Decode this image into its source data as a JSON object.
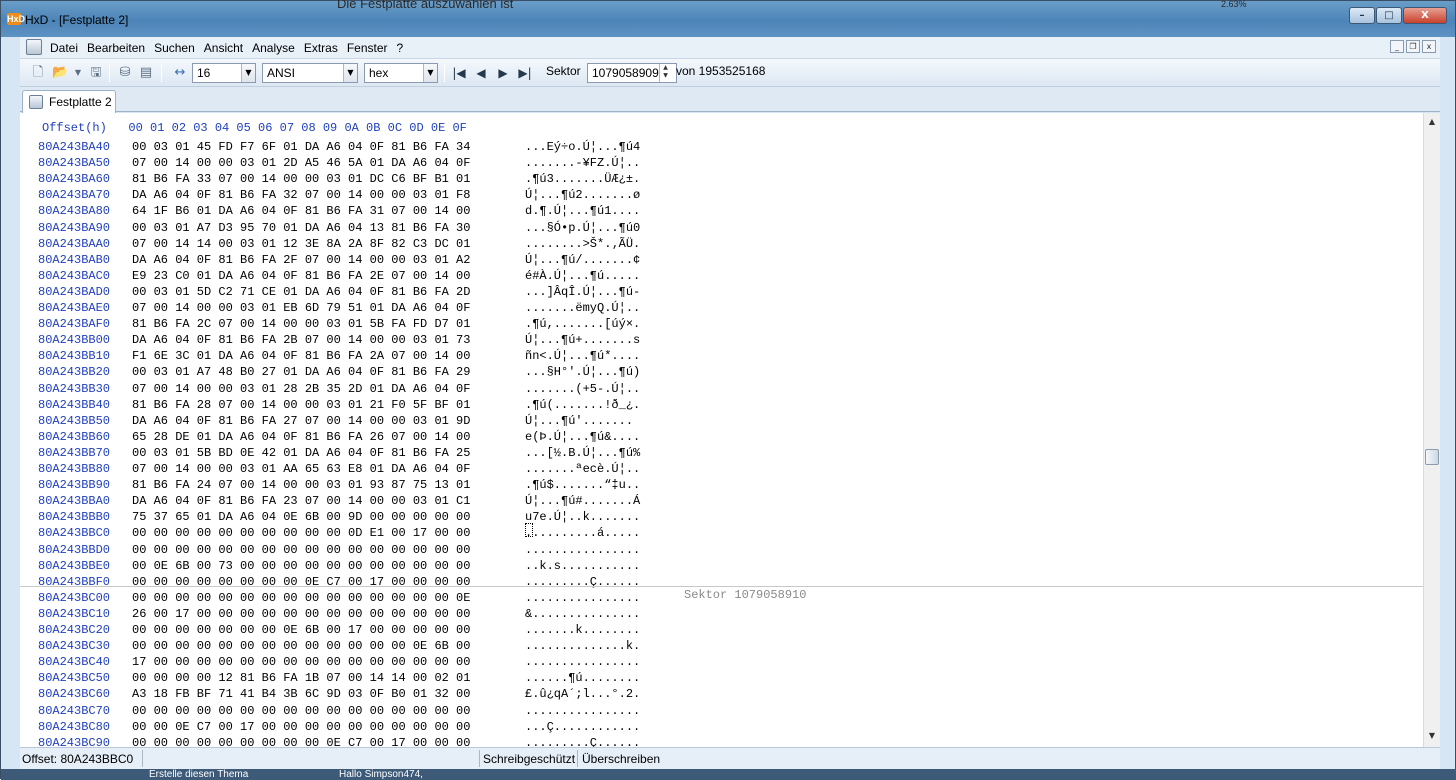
{
  "window": {
    "title": "HxD - [Festplatte 2]",
    "app_icon": "HxD",
    "bg_text_top": "Die Festplatte auszuwählen ist",
    "bg_text_right": "2.63%",
    "controls": {
      "minimize": "–",
      "maximize": "□",
      "close": "X"
    }
  },
  "menu": {
    "items": [
      "Datei",
      "Bearbeiten",
      "Suchen",
      "Ansicht",
      "Analyse",
      "Extras",
      "Fenster",
      "?"
    ],
    "mdi_controls": [
      "_",
      "❐",
      "x"
    ]
  },
  "toolbar": {
    "bytes_per_row": "16",
    "charset": "ANSI",
    "offset_base": "hex",
    "sector_label": "Sektor",
    "sector_value": "1079058909",
    "sector_total": "von 1953525168",
    "icons": [
      "new-icon",
      "open-icon",
      "save-icon",
      "disk-icon",
      "ram-icon",
      "columns-icon",
      "first-icon",
      "prev-icon",
      "next-icon",
      "last-icon"
    ]
  },
  "tab": {
    "label": "Festplatte 2"
  },
  "editor": {
    "header": "Offset(h)   00 01 02 03 04 05 06 07 08 09 0A 0B 0C 0D 0E 0F",
    "sector_label": "Sektor 1079058910",
    "rows": [
      {
        "offset": "80A243BA40",
        "hex": "00 03 01 45 FD F7 6F 01 DA A6 04 0F 81 B6 FA 34",
        "ascii": "...Eý÷o.Ú¦...¶ú4"
      },
      {
        "offset": "80A243BA50",
        "hex": "07 00 14 00 00 03 01 2D A5 46 5A 01 DA A6 04 0F",
        "ascii": ".......-¥FZ.Ú¦.."
      },
      {
        "offset": "80A243BA60",
        "hex": "81 B6 FA 33 07 00 14 00 00 03 01 DC C6 BF B1 01",
        "ascii": ".¶ú3.......ÜÆ¿±."
      },
      {
        "offset": "80A243BA70",
        "hex": "DA A6 04 0F 81 B6 FA 32 07 00 14 00 00 03 01 F8",
        "ascii": "Ú¦...¶ú2.......ø"
      },
      {
        "offset": "80A243BA80",
        "hex": "64 1F B6 01 DA A6 04 0F 81 B6 FA 31 07 00 14 00",
        "ascii": "d.¶.Ú¦...¶ú1...."
      },
      {
        "offset": "80A243BA90",
        "hex": "00 03 01 A7 D3 95 70 01 DA A6 04 13 81 B6 FA 30",
        "ascii": "...§Ó•p.Ú¦...¶ú0"
      },
      {
        "offset": "80A243BAA0",
        "hex": "07 00 14 14 00 03 01 12 3E 8A 2A 8F 82 C3 DC 01",
        "ascii": "........>Š*.‚ÃÜ."
      },
      {
        "offset": "80A243BAB0",
        "hex": "DA A6 04 0F 81 B6 FA 2F 07 00 14 00 00 03 01 A2",
        "ascii": "Ú¦...¶ú/.......¢"
      },
      {
        "offset": "80A243BAC0",
        "hex": "E9 23 C0 01 DA A6 04 0F 81 B6 FA 2E 07 00 14 00",
        "ascii": "é#À.Ú¦...¶ú....."
      },
      {
        "offset": "80A243BAD0",
        "hex": "00 03 01 5D C2 71 CE 01 DA A6 04 0F 81 B6 FA 2D",
        "ascii": "...]ÂqÎ.Ú¦...¶ú-"
      },
      {
        "offset": "80A243BAE0",
        "hex": "07 00 14 00 00 03 01 EB 6D 79 51 01 DA A6 04 0F",
        "ascii": ".......ëmyQ.Ú¦.."
      },
      {
        "offset": "80A243BAF0",
        "hex": "81 B6 FA 2C 07 00 14 00 00 03 01 5B FA FD D7 01",
        "ascii": ".¶ú,.......[úý×."
      },
      {
        "offset": "80A243BB00",
        "hex": "DA A6 04 0F 81 B6 FA 2B 07 00 14 00 00 03 01 73",
        "ascii": "Ú¦...¶ú+.......s"
      },
      {
        "offset": "80A243BB10",
        "hex": "F1 6E 3C 01 DA A6 04 0F 81 B6 FA 2A 07 00 14 00",
        "ascii": "ñn<.Ú¦...¶ú*...."
      },
      {
        "offset": "80A243BB20",
        "hex": "00 03 01 A7 48 B0 27 01 DA A6 04 0F 81 B6 FA 29",
        "ascii": "...§H°'.Ú¦...¶ú)"
      },
      {
        "offset": "80A243BB30",
        "hex": "07 00 14 00 00 03 01 28 2B 35 2D 01 DA A6 04 0F",
        "ascii": ".......(+5-.Ú¦.."
      },
      {
        "offset": "80A243BB40",
        "hex": "81 B6 FA 28 07 00 14 00 00 03 01 21 F0 5F BF 01",
        "ascii": ".¶ú(.......!ð_¿."
      },
      {
        "offset": "80A243BB50",
        "hex": "DA A6 04 0F 81 B6 FA 27 07 00 14 00 00 03 01 9D",
        "ascii": "Ú¦...¶ú'......."
      },
      {
        "offset": "80A243BB60",
        "hex": "65 28 DE 01 DA A6 04 0F 81 B6 FA 26 07 00 14 00",
        "ascii": "e(Þ.Ú¦...¶ú&...."
      },
      {
        "offset": "80A243BB70",
        "hex": "00 03 01 5B BD 0E 42 01 DA A6 04 0F 81 B6 FA 25",
        "ascii": "...[½.B.Ú¦...¶ú%"
      },
      {
        "offset": "80A243BB80",
        "hex": "07 00 14 00 00 03 01 AA 65 63 E8 01 DA A6 04 0F",
        "ascii": ".......ªecè.Ú¦.."
      },
      {
        "offset": "80A243BB90",
        "hex": "81 B6 FA 24 07 00 14 00 00 03 01 93 87 75 13 01",
        "ascii": ".¶ú$.......“‡u.."
      },
      {
        "offset": "80A243BBA0",
        "hex": "DA A6 04 0F 81 B6 FA 23 07 00 14 00 00 03 01 C1",
        "ascii": "Ú¦...¶ú#.......Á"
      },
      {
        "offset": "80A243BBB0",
        "hex": "75 37 65 01 DA A6 04 0E 6B 00 9D 00 00 00 00 00",
        "ascii": "u7e.Ú¦..k......."
      },
      {
        "offset": "80A243BBC0",
        "hex": "00 00 00 00 00 00 00 00 00 00 0D E1 00 17 00 00",
        "ascii": "..........á....."
      },
      {
        "offset": "80A243BBD0",
        "hex": "00 00 00 00 00 00 00 00 00 00 00 00 00 00 00 00",
        "ascii": "................"
      },
      {
        "offset": "80A243BBE0",
        "hex": "00 0E 6B 00 73 00 00 00 00 00 00 00 00 00 00 00",
        "ascii": "..k.s..........."
      },
      {
        "offset": "80A243BBF0",
        "hex": "00 00 00 00 00 00 00 00 0E C7 00 17 00 00 00 00",
        "ascii": ".........Ç......"
      },
      {
        "offset": "80A243BC00",
        "hex": "00 00 00 00 00 00 00 00 00 00 00 00 00 00 00 0E",
        "ascii": "................"
      },
      {
        "offset": "80A243BC10",
        "hex": "26 00 17 00 00 00 00 00 00 00 00 00 00 00 00 00",
        "ascii": "&..............."
      },
      {
        "offset": "80A243BC20",
        "hex": "00 00 00 00 00 00 00 0E 6B 00 17 00 00 00 00 00",
        "ascii": ".......k........"
      },
      {
        "offset": "80A243BC30",
        "hex": "00 00 00 00 00 00 00 00 00 00 00 00 00 0E 6B 00",
        "ascii": "..............k."
      },
      {
        "offset": "80A243BC40",
        "hex": "17 00 00 00 00 00 00 00 00 00 00 00 00 00 00 00",
        "ascii": "................"
      },
      {
        "offset": "80A243BC50",
        "hex": "00 00 00 00 12 81 B6 FA 1B 07 00 14 14 00 02 01",
        "ascii": "......¶ú........"
      },
      {
        "offset": "80A243BC60",
        "hex": "A3 18 FB BF 71 41 B4 3B 6C 9D 03 0F B0 01 32 00",
        "ascii": "£.û¿qA´;l...°.2."
      },
      {
        "offset": "80A243BC70",
        "hex": "00 00 00 00 00 00 00 00 00 00 00 00 00 00 00 00",
        "ascii": "................"
      },
      {
        "offset": "80A243BC80",
        "hex": "00 00 0E C7 00 17 00 00 00 00 00 00 00 00 00 00",
        "ascii": "...Ç............"
      },
      {
        "offset": "80A243BC90",
        "hex": "00 00 00 00 00 00 00 00 00 0E C7 00 17 00 00 00",
        "ascii": ".........Ç......"
      }
    ]
  },
  "status": {
    "offset": "Offset: 80A243BBC0",
    "protection": "Schreibgeschützt",
    "mode": "Überschreiben"
  },
  "background": {
    "task_left": "Erstelle diesen Thema",
    "task_mid": "Hallo Simpson474,"
  },
  "colors": {
    "offset": "#1f3fbf",
    "title_bar": "#5d93c3",
    "sector_label": "#8a8a8a"
  }
}
